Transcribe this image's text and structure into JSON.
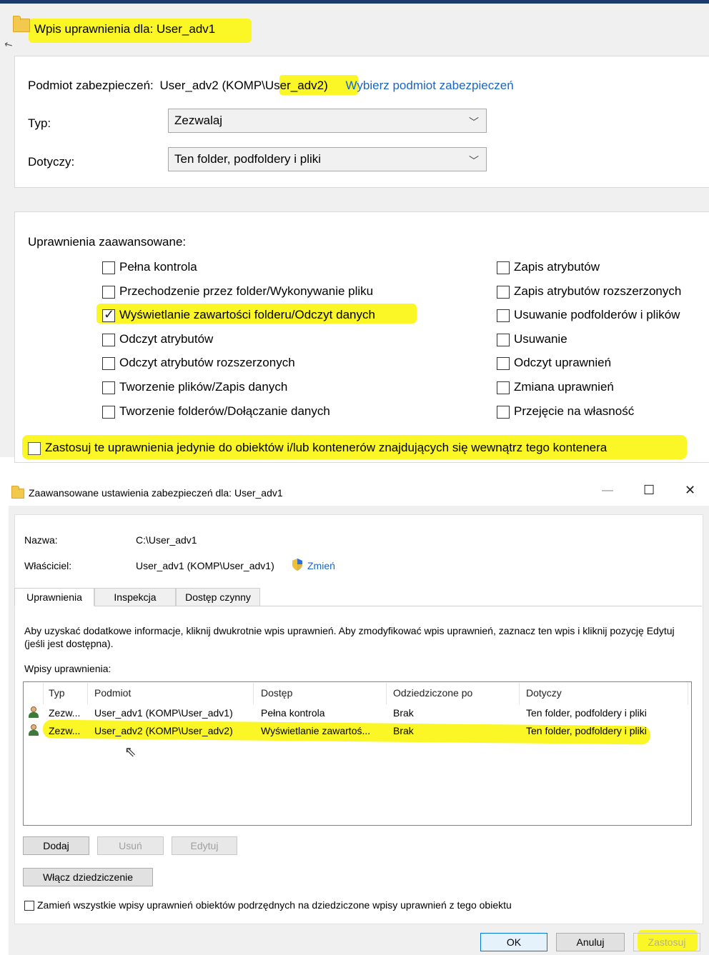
{
  "top_dialog": {
    "title": "Wpis uprawnienia dla: User_adv1",
    "principal_label": "Podmiot zabezpieczeń:",
    "principal_value_prefix": "User_adv2 (KOMP\\",
    "principal_value_hl": "User_adv2)",
    "select_principal_link": "Wybierz podmiot zabezpieczeń",
    "type_label": "Typ:",
    "type_value": "Zezwalaj",
    "applies_label": "Dotyczy:",
    "applies_value": "Ten folder, podfoldery i pliki",
    "advanced_label": "Uprawnienia zaawansowane:",
    "perms_left": [
      {
        "label": "Pełna kontrola",
        "checked": false
      },
      {
        "label": "Przechodzenie przez folder/Wykonywanie pliku",
        "checked": false
      },
      {
        "label": "Wyświetlanie zawartości folderu/Odczyt danych",
        "checked": true
      },
      {
        "label": "Odczyt atrybutów",
        "checked": false
      },
      {
        "label": "Odczyt atrybutów rozszerzonych",
        "checked": false
      },
      {
        "label": "Tworzenie plików/Zapis danych",
        "checked": false
      },
      {
        "label": "Tworzenie folderów/Dołączanie danych",
        "checked": false
      }
    ],
    "perms_right": [
      {
        "label": "Zapis atrybutów",
        "checked": false
      },
      {
        "label": "Zapis atrybutów rozszerzonych",
        "checked": false
      },
      {
        "label": "Usuwanie podfolderów i plików",
        "checked": false
      },
      {
        "label": "Usuwanie",
        "checked": false
      },
      {
        "label": "Odczyt uprawnień",
        "checked": false
      },
      {
        "label": "Zmiana uprawnień",
        "checked": false
      },
      {
        "label": "Przejęcie na własność",
        "checked": false
      }
    ],
    "apply_only_label": "Zastosuj te uprawnienia jedynie do obiektów i/lub kontenerów znajdujących się wewnątrz tego kontenera"
  },
  "adv_dialog": {
    "title": "Zaawansowane ustawienia zabezpieczeń dla: User_adv1",
    "minimize_icon": "—",
    "maximize_icon": "☐",
    "close_icon": "✕",
    "name_label": "Nazwa:",
    "name_value": "C:\\User_adv1",
    "owner_label": "Właściciel:",
    "owner_value": "User_adv1 (KOMP\\User_adv1)",
    "change_link": "Zmień",
    "tabs": [
      "Uprawnienia",
      "Inspekcja",
      "Dostęp czynny"
    ],
    "info_text": "Aby uzyskać dodatkowe informacje, kliknij dwukrotnie wpis uprawnień. Aby zmodyfikować wpis uprawnień, zaznacz ten wpis i kliknij pozycję Edytuj (jeśli jest dostępna).",
    "entries_label": "Wpisy uprawnienia:",
    "columns": [
      "Typ",
      "Podmiot",
      "Dostęp",
      "Odziedziczone po",
      "Dotyczy"
    ],
    "rows": [
      [
        "Zezw...",
        "User_adv1 (KOMP\\User_adv1)",
        "Pełna kontrola",
        "Brak",
        "Ten folder, podfoldery i pliki"
      ],
      [
        "Zezw...",
        "User_adv2 (KOMP\\User_adv2)",
        "Wyświetlanie zawartoś...",
        "Brak",
        "Ten folder, podfoldery i pliki"
      ]
    ],
    "buttons": {
      "add": "Dodaj",
      "remove": "Usuń",
      "edit": "Edytuj",
      "enable_inherit": "Włącz dziedziczenie"
    },
    "replace_label": "Zamień wszystkie wpisy uprawnień obiektów podrzędnych na dziedziczone wpisy uprawnień z tego obiektu",
    "footer": {
      "ok": "OK",
      "cancel": "Anuluj",
      "apply": "Zastosuj"
    }
  },
  "colors": {
    "highlight": "#fbf626",
    "link": "#1a66c4",
    "titlebar_line": "#1d3c6e"
  }
}
